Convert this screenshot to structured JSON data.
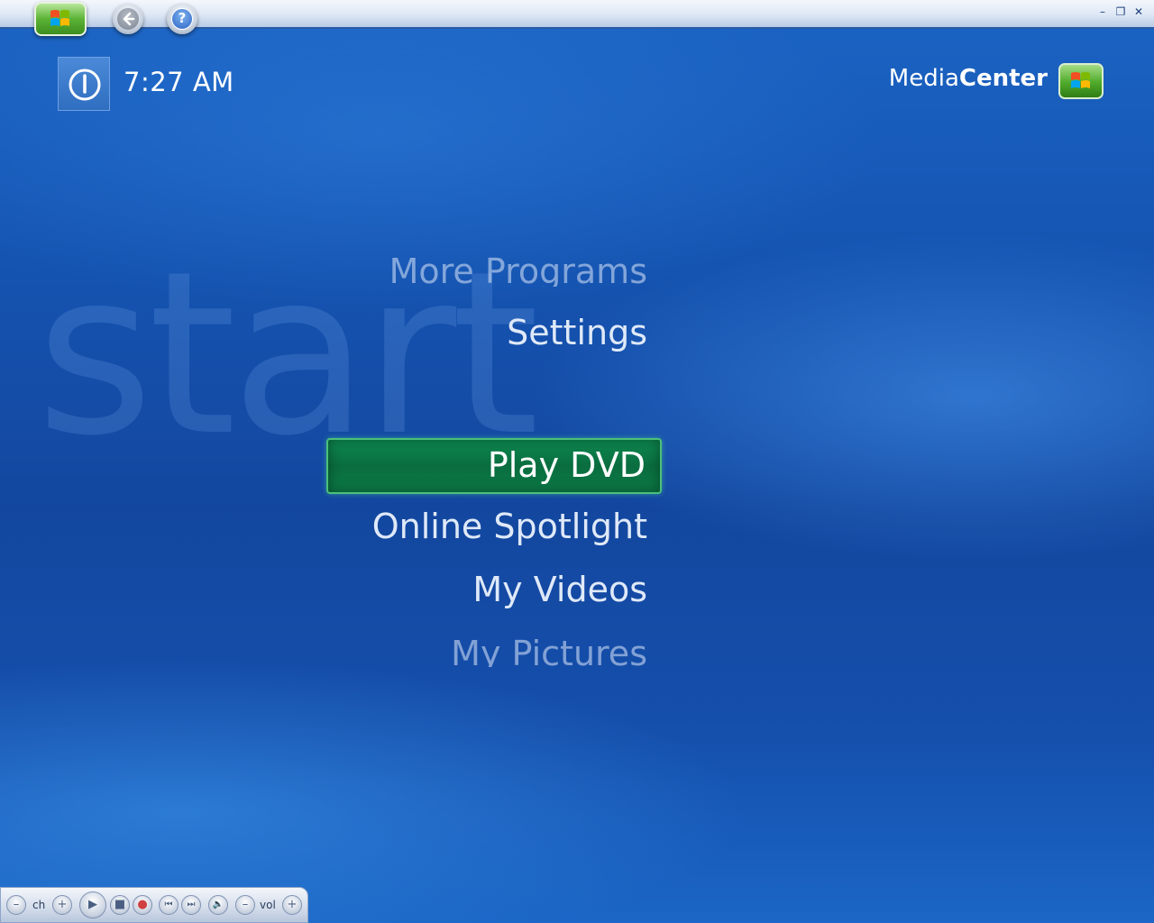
{
  "app": {
    "logo_light": "Media",
    "logo_bold": "Center"
  },
  "top_bar": {
    "start_icon": "windows-flag-icon",
    "back_icon": "back-arrow-icon",
    "help_icon": "help-icon",
    "help_glyph": "?",
    "window_controls": {
      "minimize": "–",
      "restore": "❐",
      "close": "✕"
    }
  },
  "clock": {
    "power_icon": "power-icon",
    "time": "7:27 AM"
  },
  "watermark": "start",
  "menu": {
    "items": [
      {
        "label": "More Programs",
        "state": "faded"
      },
      {
        "label": "Settings",
        "state": "normal"
      },
      {
        "label": "Play DVD",
        "state": "focused"
      },
      {
        "label": "Online Spotlight",
        "state": "normal"
      },
      {
        "label": "My Videos",
        "state": "normal"
      },
      {
        "label": "My Pictures",
        "state": "faded"
      }
    ]
  },
  "transport": {
    "channel_label": "ch",
    "volume_label": "vol",
    "minus_glyph": "–",
    "plus_glyph": "+",
    "play_glyph": "▶",
    "stop_glyph": "■",
    "record_glyph": "●",
    "prev_glyph": "⏮",
    "next_glyph": "⏭",
    "mute_glyph": "🔈"
  },
  "colors": {
    "background_blue": "#1553b0",
    "focus_green": "#0a6d3f",
    "focus_border": "#4cc07a",
    "text": "#dfe9f8"
  }
}
